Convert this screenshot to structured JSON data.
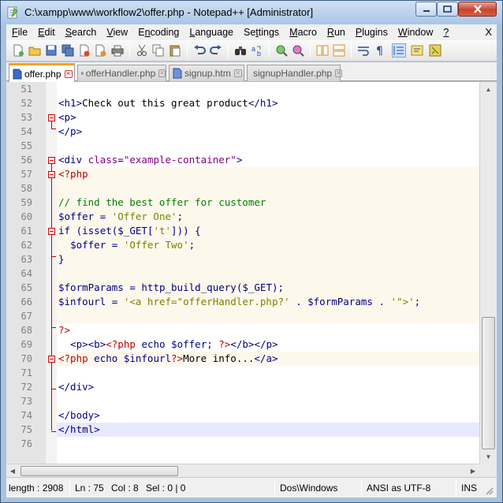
{
  "window": {
    "title": "C:\\xampp\\www\\workflow2\\offer.php - Notepad++ [Administrator]",
    "buttons": {
      "minimize": "minimize",
      "maximize": "maximize",
      "close": "close"
    }
  },
  "menu": {
    "items": [
      {
        "label": "File",
        "accel": "F"
      },
      {
        "label": "Edit",
        "accel": "E"
      },
      {
        "label": "Search",
        "accel": "S"
      },
      {
        "label": "View",
        "accel": "V"
      },
      {
        "label": "Encoding",
        "accel": "n"
      },
      {
        "label": "Language",
        "accel": "L"
      },
      {
        "label": "Settings",
        "accel": "t"
      },
      {
        "label": "Macro",
        "accel": "M"
      },
      {
        "label": "Run",
        "accel": "R"
      },
      {
        "label": "Plugins",
        "accel": "P"
      },
      {
        "label": "Window",
        "accel": "W"
      },
      {
        "label": "?",
        "accel": "?"
      }
    ],
    "close": "X"
  },
  "toolbar": {
    "buttons": [
      "new",
      "open",
      "save",
      "save-all",
      "close",
      "close-all",
      "print",
      "cut",
      "copy",
      "paste",
      "undo",
      "redo",
      "find",
      "replace",
      "zoom-in",
      "zoom-out",
      "sync-vertical",
      "sync-horizontal",
      "word-wrap",
      "show-all-chars",
      "indent-guide",
      "user-language",
      "doc-map"
    ]
  },
  "tabs": [
    {
      "label": "offer.php",
      "active": true
    },
    {
      "label": "offerHandler.php",
      "active": false
    },
    {
      "label": "signup.htm",
      "active": false
    },
    {
      "label": "signupHandler.php",
      "active": false
    }
  ],
  "editor": {
    "current_line": 75,
    "lines": [
      {
        "n": "51",
        "code": ""
      },
      {
        "n": "52",
        "code": "<h1>Check out this great product</h1>"
      },
      {
        "n": "53",
        "code": "<p>"
      },
      {
        "n": "54",
        "code": "</p>"
      },
      {
        "n": "55",
        "code": ""
      },
      {
        "n": "56",
        "code": "<div class=\"example-container\">"
      },
      {
        "n": "57",
        "code": "<?php"
      },
      {
        "n": "58",
        "code": ""
      },
      {
        "n": "59",
        "code": "// find the best offer for customer"
      },
      {
        "n": "60",
        "code": "$offer = 'Offer One';"
      },
      {
        "n": "61",
        "code": "if (isset($_GET['t'])) {"
      },
      {
        "n": "62",
        "code": "  $offer = 'Offer Two';"
      },
      {
        "n": "63",
        "code": "}"
      },
      {
        "n": "64",
        "code": ""
      },
      {
        "n": "65",
        "code": "$formParams = http_build_query($_GET);"
      },
      {
        "n": "66",
        "code": "$infourl = '<a href=\"offerHandler.php?' . $formParams . '\">';"
      },
      {
        "n": "67",
        "code": ""
      },
      {
        "n": "68",
        "code": "?>"
      },
      {
        "n": "69",
        "code": "  <p><b><?php echo $offer; ?></b></p>"
      },
      {
        "n": "70",
        "code": "<?php echo $infourl?>More info...</a>"
      },
      {
        "n": "71",
        "code": ""
      },
      {
        "n": "72",
        "code": "</div>"
      },
      {
        "n": "73",
        "code": ""
      },
      {
        "n": "74",
        "code": "</body>"
      },
      {
        "n": "75",
        "code": "</html>"
      },
      {
        "n": "76",
        "code": ""
      }
    ]
  },
  "status": {
    "length": "length : 2908",
    "line": "Ln : 75",
    "col": "Col : 8",
    "sel": "Sel : 0 | 0",
    "eol": "Dos\\Windows",
    "encoding": "ANSI as UTF-8",
    "mode": "INS"
  },
  "colors": {
    "tag": "#00007f",
    "php_delim": "#c00000",
    "comment": "#008000",
    "string": "#7f007f",
    "fold_marker": "#cc0000",
    "current_line": "#e8e8ff"
  }
}
